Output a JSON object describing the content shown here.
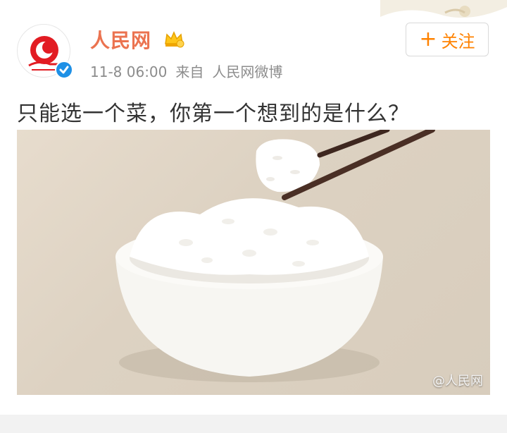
{
  "post": {
    "author_name": "人民网",
    "timestamp": "11-8 06:00",
    "source_prefix": "来自",
    "source_name": "人民网微博",
    "text": "只能选一个菜，你第一个想到的是什么？",
    "follow_label": "关注",
    "image_watermark": "@人民网"
  },
  "icons": {
    "avatar": "people-daily-logo",
    "verified": "verified-badge-icon",
    "vip": "crown-icon",
    "follow": "plus-icon"
  },
  "colors": {
    "name": "#eb7350",
    "follow": "#ff8200",
    "meta": "#8c8c8c",
    "text": "#333333",
    "verified": "#1e90e6"
  }
}
